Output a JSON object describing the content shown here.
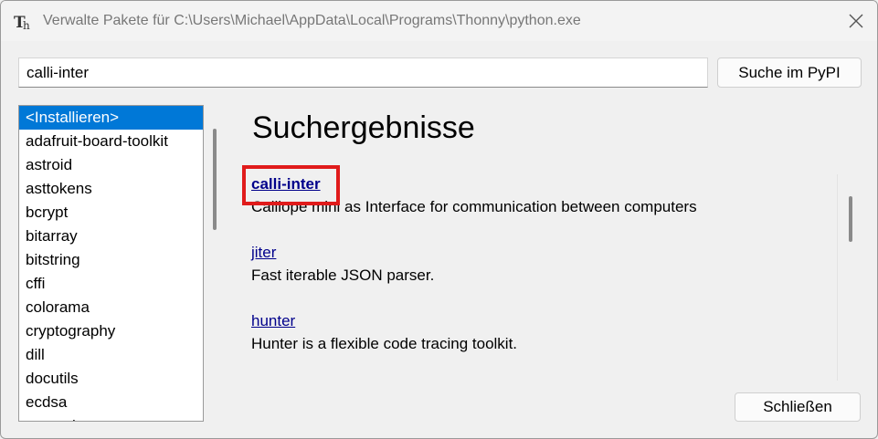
{
  "window": {
    "title": "Verwalte Pakete für C:\\Users\\Michael\\AppData\\Local\\Programs\\Thonny\\python.exe"
  },
  "search": {
    "value": "calli-inter",
    "button_label": "Suche im PyPI"
  },
  "packages": [
    "<Installieren>",
    "adafruit-board-toolkit",
    "astroid",
    "asttokens",
    "bcrypt",
    "bitarray",
    "bitstring",
    "cffi",
    "colorama",
    "cryptography",
    "dill",
    "docutils",
    "ecdsa",
    "esptool"
  ],
  "results": {
    "heading": "Suchergebnisse",
    "items": [
      {
        "name": "calli-inter",
        "description": "Calliope mini as Interface for communication between computers"
      },
      {
        "name": "jiter",
        "description": "Fast iterable JSON parser."
      },
      {
        "name": "hunter",
        "description": "Hunter is a flexible code tracing toolkit."
      }
    ]
  },
  "footer": {
    "close_label": "Schließen"
  },
  "colors": {
    "selection": "#0078d7",
    "highlight": "#e01b1b",
    "link": "#00008b"
  }
}
